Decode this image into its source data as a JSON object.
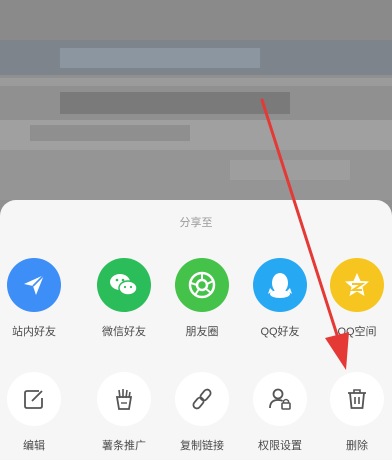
{
  "sheet": {
    "title": "分享至"
  },
  "share_targets": [
    {
      "label": "站内好友",
      "icon": "paper-plane-icon",
      "color": "#3e8ef7"
    },
    {
      "label": "微信好友",
      "icon": "wechat-icon",
      "color": "#2bbd5a"
    },
    {
      "label": "朋友圈",
      "icon": "moments-icon",
      "color": "#45c249"
    },
    {
      "label": "QQ好友",
      "icon": "qq-icon",
      "color": "#27a8f2"
    },
    {
      "label": "QQ空间",
      "icon": "qzone-icon",
      "color": "#f7c51f"
    }
  ],
  "actions": [
    {
      "label": "编辑",
      "icon": "edit-icon"
    },
    {
      "label": "薯条推广",
      "icon": "fries-icon"
    },
    {
      "label": "复制链接",
      "icon": "link-icon"
    },
    {
      "label": "权限设置",
      "icon": "user-lock-icon"
    },
    {
      "label": "删除",
      "icon": "trash-icon"
    }
  ],
  "colors": {
    "sheet_background": "#f6f6f6",
    "annotation_arrow": "#e53935"
  }
}
